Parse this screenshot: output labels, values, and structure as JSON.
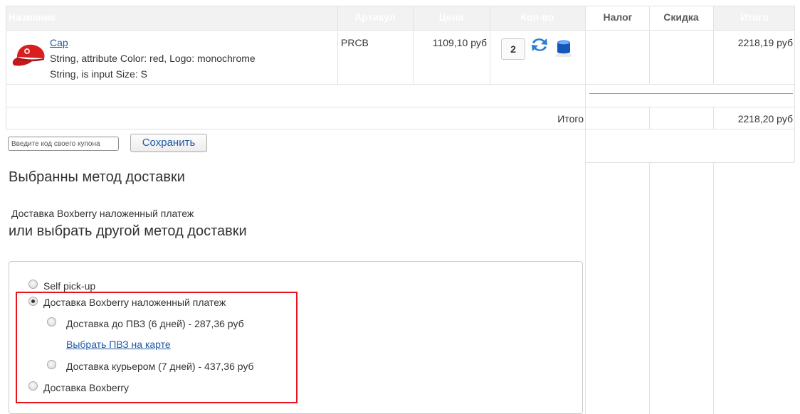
{
  "table": {
    "headers": {
      "name": "Название",
      "sku": "Артикул",
      "price": "Цена",
      "qty": "Кол-во",
      "tax": "Налог",
      "discount": "Скидка",
      "total": "Итого"
    },
    "item": {
      "name": "Cap",
      "attr1": "String, attribute Color: red, Logo: monochrome",
      "attr2": "String, is input Size: S",
      "sku": "PRCB",
      "price": "1109,10 руб",
      "qty": "2",
      "total": "2218,19 руб"
    },
    "subtotal_label": "Итого",
    "subtotal_value": "2218,20 руб"
  },
  "coupon": {
    "placeholder": "Введите код своего купона",
    "save_label": "Сохранить"
  },
  "shipping": {
    "selected_heading": "Выбранны метод доставки",
    "selected_method": "Доставка Boxberry наложенный платеж",
    "other_heading": "или выбрать другой метод доставки",
    "options": [
      "Self pick-up",
      "Доставка Boxberry наложенный платеж",
      "Доставка до ПВЗ (6 дней) - 287,36 руб",
      "Выбрать ПВЗ на карте",
      "Доставка курьером (7 дней) - 437,36 руб",
      "Доставка Boxberry"
    ]
  },
  "icons": {
    "product": "red-cap-icon",
    "update": "refresh-icon",
    "delete": "trash-icon"
  },
  "colors": {
    "header_bg": "#f2f2f2",
    "link": "#1f5aa6",
    "highlight": "#e8121b"
  }
}
